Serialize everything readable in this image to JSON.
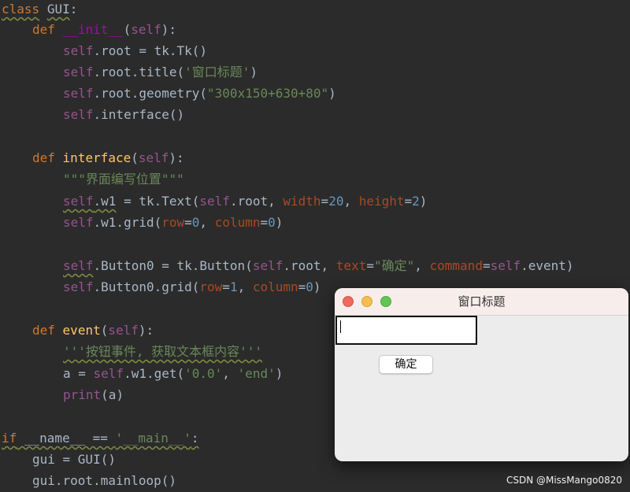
{
  "code": {
    "lines": [
      {
        "kw": "class",
        "name": "GUI",
        "rest": ":"
      },
      {
        "kw": "def",
        "name": "__init__",
        "p_open": "(",
        "self": "self",
        "p_close": "):"
      },
      {
        "self": "self",
        "text": ".root = tk.Tk()"
      },
      {
        "self": "self",
        "text": ".root.title(",
        "str": "'窗口标题'",
        "end": ")"
      },
      {
        "self": "self",
        "text": ".root.geometry(",
        "str": "\"300x150+630+80\"",
        "end": ")"
      },
      {
        "self": "self",
        "text": ".interface()"
      },
      {
        "kw": "def",
        "name": "interface",
        "p_open": "(",
        "self": "self",
        "p_close": "):"
      },
      {
        "str": "\"\"\"界面编写位置\"\"\""
      },
      {
        "self": "self",
        "w1": ".w1",
        "a": " = tk.Text(",
        "self2": "self",
        "b": ".root, ",
        "p1": "width",
        "eq1": "=",
        "n1": "20",
        "c": ", ",
        "p2": "height",
        "eq2": "=",
        "n2": "2",
        "d": ")"
      },
      {
        "self": "self",
        "a": ".w1.grid(",
        "p1": "row",
        "eq1": "=",
        "n1": "0",
        "c": ", ",
        "p2": "column",
        "eq2": "=",
        "n2": "0",
        "d": ")"
      },
      {
        "self": "self",
        "a": ".Button0 = tk.Button(",
        "self2": "self",
        "b": ".root, ",
        "p1": "text",
        "eq1": "=",
        "s1": "\"确定\"",
        "c": ", ",
        "p2": "command",
        "eq2": "=",
        "self3": "self",
        "d": ".event)"
      },
      {
        "self": "self",
        "a": ".Button0.grid(",
        "p1": "row",
        "eq1": "=",
        "n1": "1",
        "c": ", ",
        "p2": "column",
        "eq2": "=",
        "n2": "0",
        "d": ")"
      },
      {
        "kw": "def",
        "name": "event",
        "p_open": "(",
        "self": "self",
        "p_close": "):"
      },
      {
        "str": "'''按钮事件, 获取文本框内容'''"
      },
      {
        "a": "a = ",
        "self": "self",
        "b": ".w1.get(",
        "s1": "'0.0'",
        "c": ", ",
        "s2": "'end'",
        "d": ")"
      },
      {
        "fn": "print",
        "rest": "(a)"
      },
      {
        "kw": "if",
        "a": " __name__ == ",
        "str": "'__main__'",
        "end": ":"
      },
      {
        "text": "gui = GUI()"
      },
      {
        "text": "gui.root.mainloop()"
      }
    ]
  },
  "tk_window": {
    "title": "窗口标题",
    "button_label": "确定",
    "textbox_value": ""
  },
  "watermark": "CSDN @MissMango0820"
}
